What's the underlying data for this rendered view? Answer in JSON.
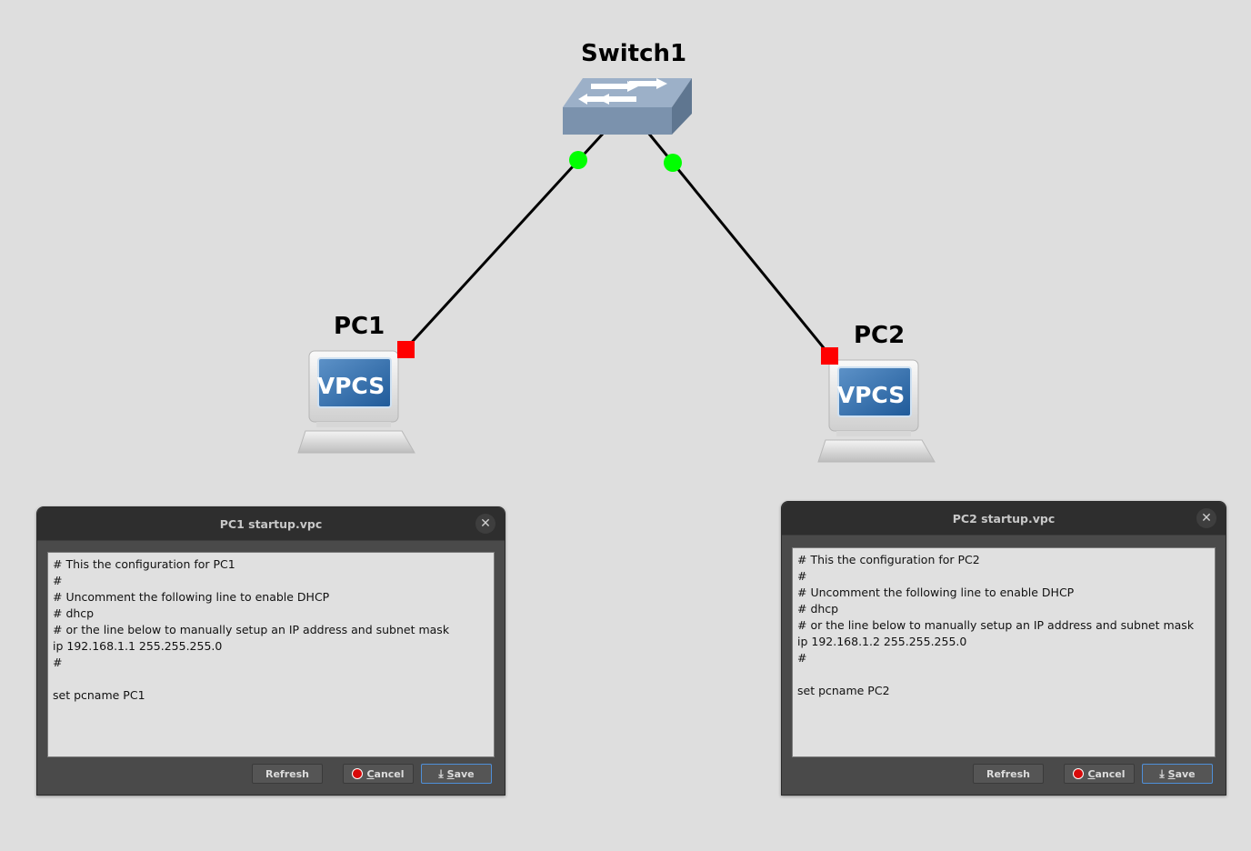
{
  "nodes": {
    "switch1": {
      "label": "Switch1"
    },
    "pc1": {
      "label": "PC1",
      "badge": "VPCS"
    },
    "pc2": {
      "label": "PC2",
      "badge": "VPCS"
    }
  },
  "link_status_colors": {
    "up": "#00ff00",
    "down": "#ff0000"
  },
  "dialogs": {
    "pc1": {
      "title": "PC1 startup.vpc",
      "content": "# This the configuration for PC1\n#\n# Uncomment the following line to enable DHCP\n# dhcp\n# or the line below to manually setup an IP address and subnet mask\nip 192.168.1.1 255.255.255.0\n#\n\nset pcname PC1",
      "refresh_label": "Refresh",
      "cancel_mnemonic": "C",
      "cancel_rest": "ancel",
      "save_mnemonic": "S",
      "save_rest": "ave"
    },
    "pc2": {
      "title": "PC2 startup.vpc",
      "content": "# This the configuration for PC2\n#\n# Uncomment the following line to enable DHCP\n# dhcp\n# or the line below to manually setup an IP address and subnet mask\nip 192.168.1.2 255.255.255.0\n#\n\nset pcname PC2",
      "refresh_label": "Refresh",
      "cancel_mnemonic": "C",
      "cancel_rest": "ancel",
      "save_mnemonic": "S",
      "save_rest": "ave"
    }
  },
  "icons": {
    "close": "close-icon",
    "cancel": "stop-icon",
    "save": "download-icon"
  }
}
